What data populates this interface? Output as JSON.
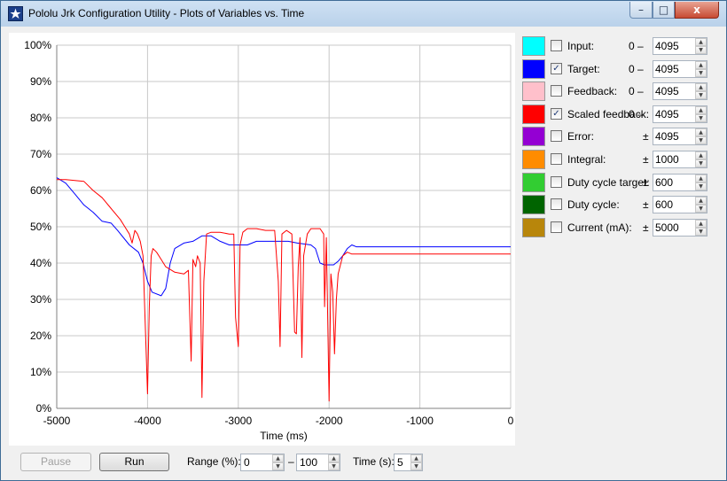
{
  "window": {
    "title": "Pololu Jrk Configuration Utility - Plots of Variables vs. Time",
    "minimize_glyph": "–",
    "maximize_glyph": "□",
    "close_glyph": "x"
  },
  "legend": [
    {
      "label": "Input:",
      "checked": false,
      "color": "#00ffff",
      "range_prefix": "0 –",
      "value": "4095"
    },
    {
      "label": "Target:",
      "checked": true,
      "color": "#0000ff",
      "range_prefix": "0 –",
      "value": "4095"
    },
    {
      "label": "Feedback:",
      "checked": false,
      "color": "#ffc0cb",
      "range_prefix": "0 –",
      "value": "4095"
    },
    {
      "label": "Scaled feedback:",
      "checked": true,
      "color": "#ff0000",
      "range_prefix": "0 –",
      "value": "4095"
    },
    {
      "label": "Error:",
      "checked": false,
      "color": "#9400d3",
      "range_prefix": "±",
      "value": "4095"
    },
    {
      "label": "Integral:",
      "checked": false,
      "color": "#ff8c00",
      "range_prefix": "±",
      "value": "1000"
    },
    {
      "label": "Duty cycle target:",
      "checked": false,
      "color": "#32cd32",
      "range_prefix": "±",
      "value": "600"
    },
    {
      "label": "Duty cycle:",
      "checked": false,
      "color": "#006400",
      "range_prefix": "±",
      "value": "600"
    },
    {
      "label": "Current (mA):",
      "checked": false,
      "color": "#b8860b",
      "range_prefix": "±",
      "value": "5000"
    }
  ],
  "controls": {
    "pause_label": "Pause",
    "run_label": "Run",
    "range_label": "Range (%):",
    "range_min": "0",
    "range_dash": "–",
    "range_max": "100",
    "time_label": "Time (s):",
    "time_value": "5"
  },
  "chart_data": {
    "type": "line",
    "xlabel": "Time (ms)",
    "ylabel": "",
    "xlim": [
      -5000,
      0
    ],
    "ylim": [
      0,
      100
    ],
    "grid": true,
    "x_ticks": [
      "-5000",
      "-4000",
      "-3000",
      "-2000",
      "-1000",
      "0"
    ],
    "y_ticks": [
      "0%",
      "10%",
      "20%",
      "30%",
      "40%",
      "50%",
      "60%",
      "70%",
      "80%",
      "90%",
      "100%"
    ],
    "series": [
      {
        "name": "Target",
        "color": "#0000ff",
        "points": [
          [
            -5000,
            63.5
          ],
          [
            -4900,
            62
          ],
          [
            -4800,
            59
          ],
          [
            -4700,
            56
          ],
          [
            -4600,
            54
          ],
          [
            -4500,
            51.5
          ],
          [
            -4400,
            51
          ],
          [
            -4330,
            49
          ],
          [
            -4200,
            45
          ],
          [
            -4100,
            43
          ],
          [
            -4050,
            40
          ],
          [
            -4000,
            35
          ],
          [
            -3950,
            32
          ],
          [
            -3850,
            31
          ],
          [
            -3800,
            33
          ],
          [
            -3750,
            40
          ],
          [
            -3700,
            44
          ],
          [
            -3600,
            45.5
          ],
          [
            -3500,
            46
          ],
          [
            -3400,
            47.5
          ],
          [
            -3300,
            47.5
          ],
          [
            -3200,
            46
          ],
          [
            -3100,
            45
          ],
          [
            -2900,
            45
          ],
          [
            -2800,
            46
          ],
          [
            -2450,
            46
          ],
          [
            -2350,
            45.5
          ],
          [
            -2200,
            45
          ],
          [
            -2150,
            44
          ],
          [
            -2100,
            40
          ],
          [
            -2050,
            39.5
          ],
          [
            -1950,
            39.5
          ],
          [
            -1900,
            40.5
          ],
          [
            -1850,
            42
          ],
          [
            -1800,
            44
          ],
          [
            -1750,
            45
          ],
          [
            -1700,
            44.5
          ],
          [
            0,
            44.5
          ]
        ]
      },
      {
        "name": "Scaled feedback",
        "color": "#ff0000",
        "points": [
          [
            -5000,
            63
          ],
          [
            -4900,
            63
          ],
          [
            -4700,
            62.5
          ],
          [
            -4600,
            60
          ],
          [
            -4500,
            58
          ],
          [
            -4400,
            55
          ],
          [
            -4300,
            52
          ],
          [
            -4250,
            50
          ],
          [
            -4200,
            48
          ],
          [
            -4170,
            45.5
          ],
          [
            -4140,
            49
          ],
          [
            -4110,
            48
          ],
          [
            -4080,
            46
          ],
          [
            -4050,
            42
          ],
          [
            -4030,
            27
          ],
          [
            -4000,
            4
          ],
          [
            -3980,
            28
          ],
          [
            -3960,
            42
          ],
          [
            -3940,
            44
          ],
          [
            -3900,
            43
          ],
          [
            -3850,
            41
          ],
          [
            -3800,
            39
          ],
          [
            -3700,
            37.5
          ],
          [
            -3600,
            37
          ],
          [
            -3550,
            38
          ],
          [
            -3520,
            13
          ],
          [
            -3500,
            41
          ],
          [
            -3470,
            39
          ],
          [
            -3450,
            42
          ],
          [
            -3420,
            40
          ],
          [
            -3400,
            3
          ],
          [
            -3380,
            35
          ],
          [
            -3350,
            48
          ],
          [
            -3300,
            48.5
          ],
          [
            -3200,
            48.5
          ],
          [
            -3100,
            48
          ],
          [
            -3050,
            48
          ],
          [
            -3030,
            25
          ],
          [
            -3000,
            17
          ],
          [
            -2980,
            45
          ],
          [
            -2950,
            48.5
          ],
          [
            -2900,
            49.5
          ],
          [
            -2800,
            49.5
          ],
          [
            -2700,
            49
          ],
          [
            -2600,
            49
          ],
          [
            -2560,
            35
          ],
          [
            -2540,
            17
          ],
          [
            -2520,
            48
          ],
          [
            -2470,
            49
          ],
          [
            -2410,
            48
          ],
          [
            -2380,
            21
          ],
          [
            -2360,
            20.5
          ],
          [
            -2340,
            39
          ],
          [
            -2320,
            47
          ],
          [
            -2300,
            14
          ],
          [
            -2280,
            42
          ],
          [
            -2240,
            48
          ],
          [
            -2200,
            49.5
          ],
          [
            -2100,
            49.5
          ],
          [
            -2060,
            48
          ],
          [
            -2050,
            28
          ],
          [
            -2030,
            47
          ],
          [
            -2000,
            2
          ],
          [
            -1980,
            37
          ],
          [
            -1960,
            32
          ],
          [
            -1940,
            15
          ],
          [
            -1920,
            30
          ],
          [
            -1900,
            37
          ],
          [
            -1850,
            42
          ],
          [
            -1800,
            43
          ],
          [
            -1750,
            42.5
          ],
          [
            0,
            42.5
          ]
        ]
      }
    ]
  }
}
